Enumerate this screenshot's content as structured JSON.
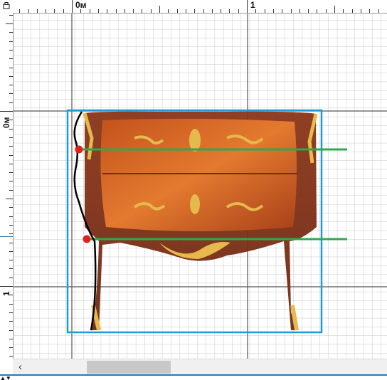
{
  "ruler": {
    "top_labels": [
      "0м",
      "1"
    ],
    "left_labels": [
      "0м",
      "1"
    ]
  },
  "colors": {
    "bounding_box": "#1e9bd7",
    "guide_line": "#2fa84f",
    "control_point": "#e0211d",
    "profile_curve": "#000000",
    "grid_minor": "#c8c8c8",
    "grid_major": "#555555",
    "accent": "#2a7ab8"
  },
  "scrollbar": {
    "left_arrow": "‹"
  },
  "icons": {
    "corner": "pin-icon",
    "bottom": "dropdown-arrows-icon"
  },
  "image": {
    "subject": "furniture-photo"
  }
}
